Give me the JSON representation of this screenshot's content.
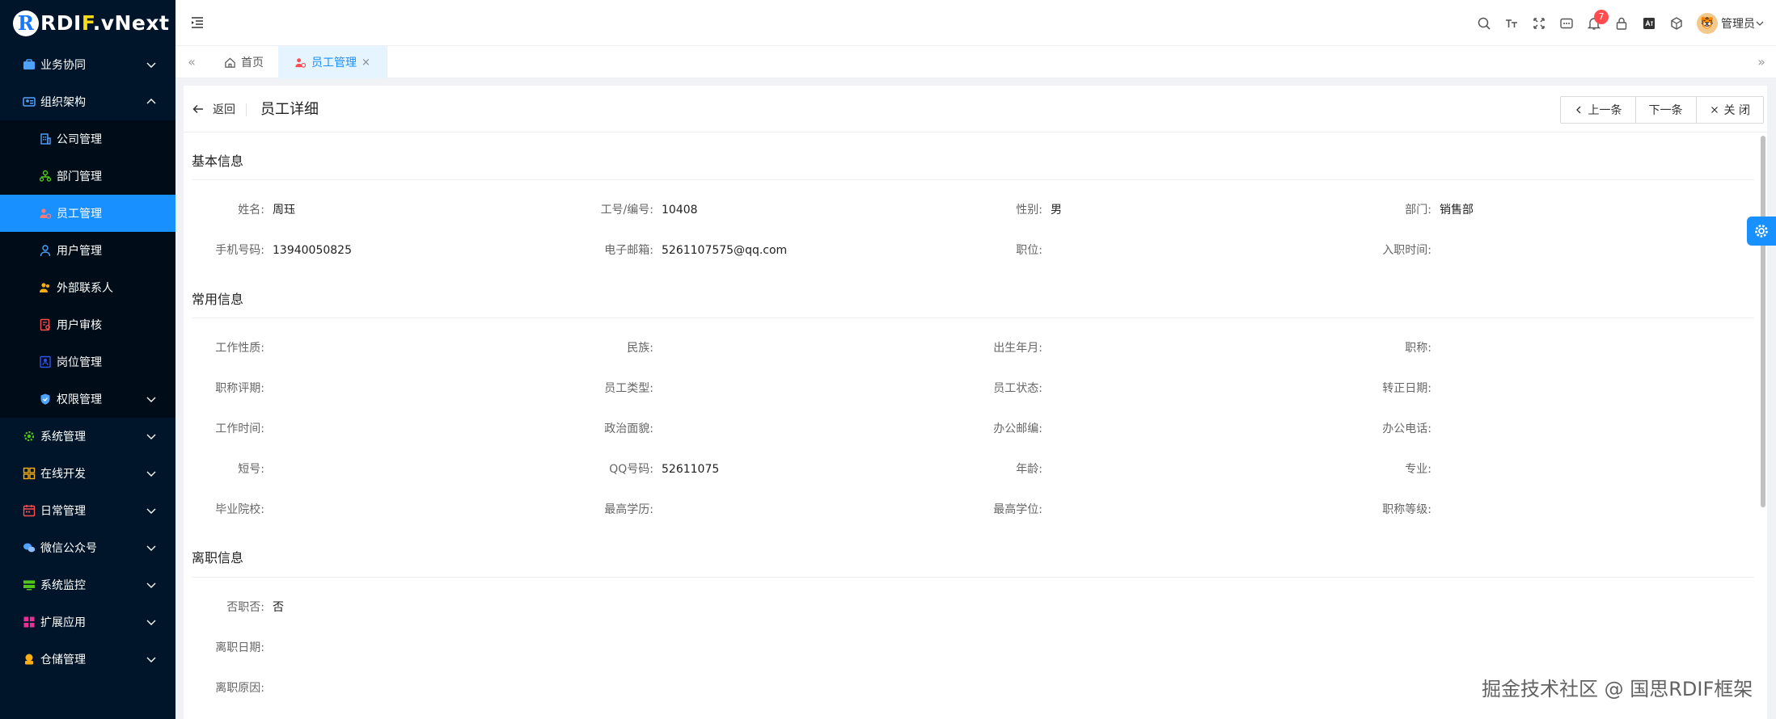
{
  "logo": {
    "letter": "R",
    "text_a": "RDI",
    "text_f": "F",
    "text_b": ".vNext"
  },
  "sidebar": {
    "items": [
      {
        "label": "业务协同",
        "icon": "briefcase-icon",
        "expanded": false
      },
      {
        "label": "组织架构",
        "icon": "org-chart-icon",
        "expanded": true
      }
    ],
    "sub_items": [
      {
        "label": "公司管理",
        "icon": "building-icon",
        "active": false
      },
      {
        "label": "部门管理",
        "icon": "department-tree-icon",
        "active": false
      },
      {
        "label": "员工管理",
        "icon": "employee-icon",
        "active": true
      },
      {
        "label": "用户管理",
        "icon": "user-icon",
        "active": false
      },
      {
        "label": "外部联系人",
        "icon": "contact-icon",
        "active": false
      },
      {
        "label": "用户审核",
        "icon": "audit-icon",
        "active": false
      },
      {
        "label": "岗位管理",
        "icon": "position-icon",
        "active": false
      },
      {
        "label": "权限管理",
        "icon": "shield-icon",
        "active": false
      }
    ],
    "bottom_items": [
      {
        "label": "系统管理",
        "icon": "gear-icon"
      },
      {
        "label": "在线开发",
        "icon": "grid-icon"
      },
      {
        "label": "日常管理",
        "icon": "calendar-icon"
      },
      {
        "label": "微信公众号",
        "icon": "wechat-icon"
      },
      {
        "label": "系统监控",
        "icon": "monitor-icon"
      },
      {
        "label": "扩展应用",
        "icon": "apps-icon"
      },
      {
        "label": "仓储管理",
        "icon": "warehouse-icon"
      }
    ]
  },
  "header": {
    "notification_count": "7",
    "user_name": "管理员"
  },
  "tabs": [
    {
      "label": "首页",
      "active": false
    },
    {
      "label": "员工管理",
      "active": true,
      "close": "×"
    }
  ],
  "page": {
    "back_label": "返回",
    "title": "员工详细",
    "prev_label": "上一条",
    "next_label": "下一条",
    "close_label": "关 闭"
  },
  "sections": {
    "basic": {
      "title": "基本信息",
      "fields": [
        {
          "label": "姓名:",
          "value": "周珏"
        },
        {
          "label": "工号/编号:",
          "value": "10408"
        },
        {
          "label": "性别:",
          "value": "男"
        },
        {
          "label": "部门:",
          "value": "销售部"
        },
        {
          "label": "手机号码:",
          "value": "13940050825"
        },
        {
          "label": "电子邮箱:",
          "value": "5261107575@qq.com"
        },
        {
          "label": "职位:",
          "value": ""
        },
        {
          "label": "入职时间:",
          "value": ""
        }
      ]
    },
    "common": {
      "title": "常用信息",
      "fields": [
        {
          "label": "工作性质:",
          "value": ""
        },
        {
          "label": "民族:",
          "value": ""
        },
        {
          "label": "出生年月:",
          "value": ""
        },
        {
          "label": "职称:",
          "value": ""
        },
        {
          "label": "职称评期:",
          "value": ""
        },
        {
          "label": "员工类型:",
          "value": ""
        },
        {
          "label": "员工状态:",
          "value": ""
        },
        {
          "label": "转正日期:",
          "value": ""
        },
        {
          "label": "工作时间:",
          "value": ""
        },
        {
          "label": "政治面貌:",
          "value": ""
        },
        {
          "label": "办公邮编:",
          "value": ""
        },
        {
          "label": "办公电话:",
          "value": ""
        },
        {
          "label": "短号:",
          "value": ""
        },
        {
          "label": "QQ号码:",
          "value": "52611075"
        },
        {
          "label": "年龄:",
          "value": ""
        },
        {
          "label": "专业:",
          "value": ""
        },
        {
          "label": "毕业院校:",
          "value": ""
        },
        {
          "label": "最高学历:",
          "value": ""
        },
        {
          "label": "最高学位:",
          "value": ""
        },
        {
          "label": "职称等级:",
          "value": ""
        }
      ]
    },
    "leave": {
      "title": "离职信息",
      "fields": [
        {
          "label": "否职否:",
          "value": "否"
        },
        {
          "label": "离职日期:",
          "value": ""
        },
        {
          "label": "离职原因:",
          "value": ""
        }
      ]
    }
  },
  "watermark": "掘金技术社区 @ 国思RDIF框架",
  "colors": {
    "sidebar_bg": "#001529",
    "submenu_bg": "#000c17",
    "accent": "#1890ff",
    "badge": "#ff4d4f"
  }
}
